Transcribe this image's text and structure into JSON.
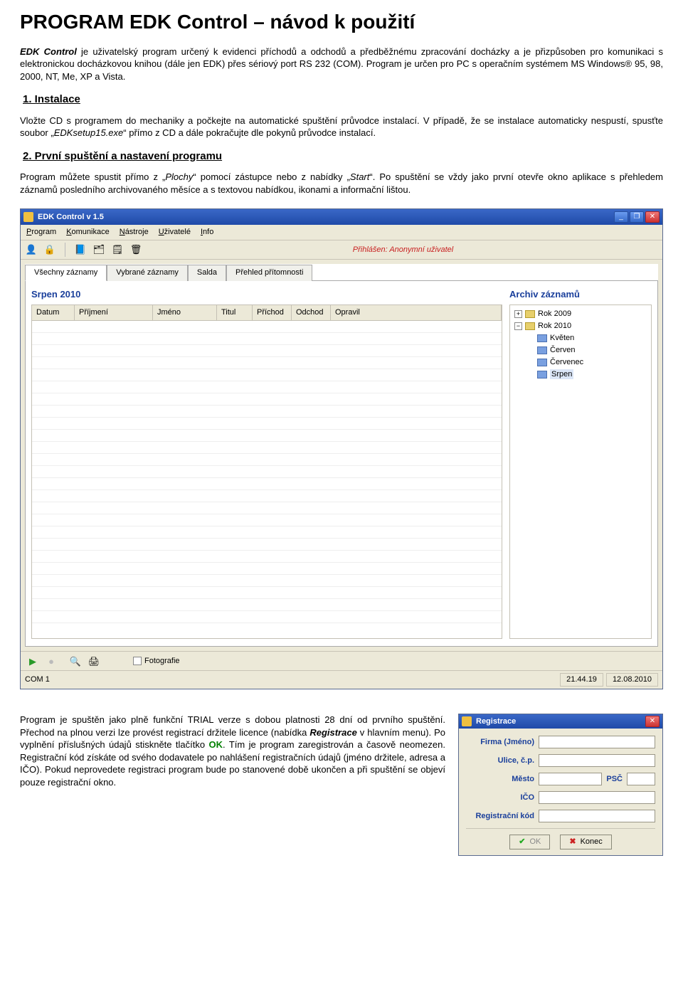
{
  "doc": {
    "title": "PROGRAM EDK Control – návod k použití",
    "intro_a": "EDK Control",
    "intro_b": " je uživatelský program určený k evidenci příchodů a odchodů a předběžnému zpracování docházky a je přizpůsoben pro komunikaci s elektronickou docházkovou knihou (dále jen EDK) přes sériový port RS 232 (COM). Program je určen pro PC s operačním systémem MS Windows® 95, 98, 2000, NT, Me, XP a Vista.",
    "sec1_head": "1. Instalace",
    "sec1_body_a": "Vložte CD s programem do mechaniky a počkejte na automatické spuštění průvodce instalací. V případě, že se instalace automaticky nespustí, spusťte soubor „",
    "sec1_body_file": "EDKsetup15.exe",
    "sec1_body_b": "“ přímo z CD a dále pokračujte dle pokynů průvodce instalací.",
    "sec2_head": "2. První spuštění a nastavení programu",
    "sec2_a": "Program můžete spustit přímo z „",
    "sec2_plochy": "Plochy",
    "sec2_b": "“ pomocí zástupce nebo z nabídky „",
    "sec2_start": "Start",
    "sec2_c": "“. Po spuštění se vždy jako první otevře okno aplikace s přehledem záznamů posledního archivovaného měsíce a s textovou nabídkou, ikonami a informační lištou.",
    "bottom_a": "Program je spuštěn jako plně funkční TRIAL verze s dobou platnosti 28 dní od prvního spuštění. Přechod na plnou verzi lze provést registrací držitele licence (nabídka ",
    "bottom_reg": "Registrace",
    "bottom_b": " v hlavním menu). Po vyplnění příslušných údajů stiskněte tlačítko ",
    "bottom_ok": "OK",
    "bottom_c": ". Tím je program zaregistrován a časově neomezen. Registrační kód získáte od svého dodavatele po nahlášení registračních údajů (jméno držitele, adresa a IČO). Pokud neprovedete registraci program bude po stanovené době ukončen a při spuštění se objeví pouze registrační okno."
  },
  "app": {
    "title": "EDK Control v 1.5",
    "menu": {
      "program": "Program",
      "komunikace": "Komunikace",
      "nastroje": "Nástroje",
      "uzivatele": "Uživatelé",
      "info": "Info"
    },
    "login_label": "Přihlášen: Anonymní uživatel",
    "tabs": {
      "t1": "Všechny záznamy",
      "t2": "Vybrané záznamy",
      "t3": "Salda",
      "t4": "Přehled přítomnosti"
    },
    "month_title": "Srpen 2010",
    "cols": {
      "datum": "Datum",
      "prijmeni": "Příjmení",
      "jmeno": "Jméno",
      "titul": "Titul",
      "prichod": "Příchod",
      "odchod": "Odchod",
      "opravil": "Opravil"
    },
    "archive": {
      "title": "Archiv záznamů",
      "y1": "Rok 2009",
      "y2": "Rok 2010",
      "m1": "Květen",
      "m2": "Červen",
      "m3": "Červenec",
      "m4": "Srpen"
    },
    "foto_label": "Fotografie",
    "status_com": "COM 1",
    "status_time": "21.44.19",
    "status_date": "12.08.2010"
  },
  "dlg": {
    "title": "Registrace",
    "firma": "Firma (Jméno)",
    "ulice": "Ulice, č.p.",
    "mesto": "Město",
    "psc": "PSČ",
    "ico": "IČO",
    "kod": "Registrační kód",
    "ok": "OK",
    "konec": "Konec"
  }
}
